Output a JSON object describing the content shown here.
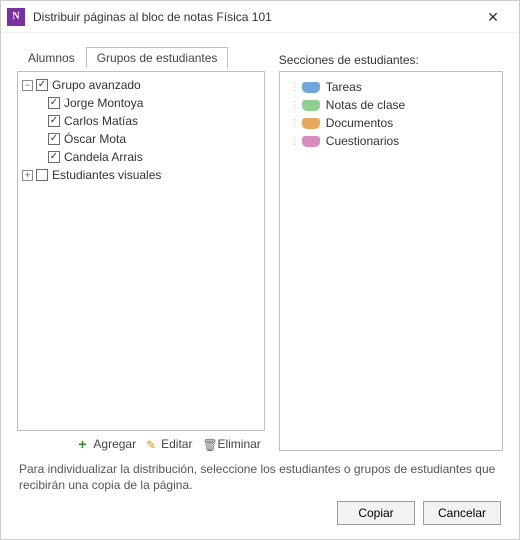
{
  "window": {
    "title": "Distribuir páginas al bloc de notas Física 101"
  },
  "tabs": {
    "alumnos": "Alumnos",
    "grupos": "Grupos de estudiantes"
  },
  "tree": {
    "group_advanced": {
      "label": "Grupo avanzado",
      "checked": true,
      "expanded": true,
      "students": [
        {
          "label": "Jorge Montoya",
          "checked": true
        },
        {
          "label": "Carlos Matías",
          "checked": true
        },
        {
          "label": "Óscar Mota",
          "checked": true
        },
        {
          "label": "Candela Arrais",
          "checked": true
        }
      ]
    },
    "group_visual": {
      "label": "Estudiantes visuales",
      "checked": false,
      "expanded": false
    }
  },
  "tree_actions": {
    "add": "Agregar",
    "edit": "Editar",
    "delete": "Eliminar"
  },
  "sections_label": "Secciones de estudiantes:",
  "sections": [
    {
      "label": "Tareas",
      "color": "#6fa8d8"
    },
    {
      "label": "Notas de clase",
      "color": "#8fcf8f"
    },
    {
      "label": "Documentos",
      "color": "#e6a85c"
    },
    {
      "label": "Cuestionarios",
      "color": "#d98bbd"
    }
  ],
  "hint": "Para individualizar la distribución, seleccione los estudiantes o grupos de estudiantes que recibirán una copia de la página.",
  "buttons": {
    "copy": "Copiar",
    "cancel": "Cancelar"
  }
}
